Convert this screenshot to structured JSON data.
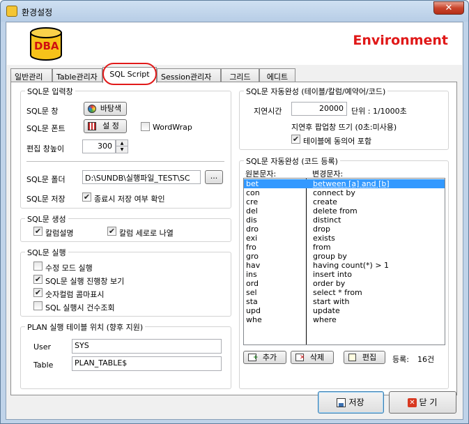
{
  "window": {
    "title": "환경설정",
    "close_label": "✕"
  },
  "header": {
    "logo_text": "DBA",
    "title": "Environment"
  },
  "tabs": [
    {
      "label": "일반관리"
    },
    {
      "label": "Table관리자"
    },
    {
      "label": "SQL Script"
    },
    {
      "label": "Session관리자"
    },
    {
      "label": "그리드"
    },
    {
      "label": "에디트"
    }
  ],
  "sql_input": {
    "title": "SQL문 입력창",
    "window_label": "SQL문 창",
    "bg_button": "바탕색",
    "font_label": "SQL문 폰트",
    "font_button": "설 정",
    "wordwrap_label": "WordWrap",
    "tab_width_label": "편집 창높이",
    "tab_width_value": "300",
    "folder_label": "SQL문 폴더",
    "folder_value": "D:\\SUNDB\\실행파일_TEST\\SC",
    "browse_label": "...",
    "save_label": "SQL문 저장",
    "save_confirm_label": "종료시 저장 여부 확인"
  },
  "sql_create": {
    "title": "SQL문 생성",
    "col_comment_label": "칼럼설명",
    "col_vertical_label": "칼럼 세로로 나열"
  },
  "sql_exec": {
    "title": "SQL문 실행",
    "items": [
      {
        "label": "수정 모드 실행",
        "checked": false
      },
      {
        "label": "SQL문 실행 진행창 보기",
        "checked": true
      },
      {
        "label": "숫자컬럼 콤마표시",
        "checked": true
      },
      {
        "label": "SQL 실행시 건수조회",
        "checked": false
      }
    ]
  },
  "plan": {
    "title": "PLAN 실행 테이블 위치 (향후 지원)",
    "user_label": "User",
    "user_value": "SYS",
    "table_label": "Table",
    "table_value": "PLAN_TABLE$"
  },
  "autocomplete": {
    "title": "SQL문 자동완성 (테이블/칼럼/예약어/코드)",
    "delay_label": "지연시간",
    "delay_value": "20000",
    "unit_label": "단위 : 1/1000초",
    "popup_label": "지연후 팝업창 뜨기 (0초:미사용)",
    "include_alias_label": "테이블에 동의어 포함"
  },
  "code_reg": {
    "title": "SQL문 자동완성 (코드 등록)",
    "col_src": "원본문자:",
    "col_dst": "변경문자:",
    "rows": [
      {
        "src": "bet",
        "dst": "between [a] and [b]"
      },
      {
        "src": "con",
        "dst": "connect by"
      },
      {
        "src": "cre",
        "dst": "create"
      },
      {
        "src": "del",
        "dst": "delete from"
      },
      {
        "src": "dis",
        "dst": "distinct"
      },
      {
        "src": "dro",
        "dst": "drop"
      },
      {
        "src": "exi",
        "dst": "exists"
      },
      {
        "src": "fro",
        "dst": "from"
      },
      {
        "src": "gro",
        "dst": "group by"
      },
      {
        "src": "hav",
        "dst": "having count(*) > 1"
      },
      {
        "src": "ins",
        "dst": "insert into"
      },
      {
        "src": "ord",
        "dst": "order by"
      },
      {
        "src": "sel",
        "dst": "select * from"
      },
      {
        "src": "sta",
        "dst": "start with"
      },
      {
        "src": "upd",
        "dst": "update"
      },
      {
        "src": "whe",
        "dst": "where"
      }
    ],
    "add_button": "추가",
    "delete_button": "삭제",
    "edit_button": "편집",
    "count_label": "등록:",
    "count_value": "16건"
  },
  "footer": {
    "save_button": "저장",
    "close_button": "닫 기"
  },
  "colors": {
    "accent": "#e01818",
    "selection": "#3399ff"
  }
}
